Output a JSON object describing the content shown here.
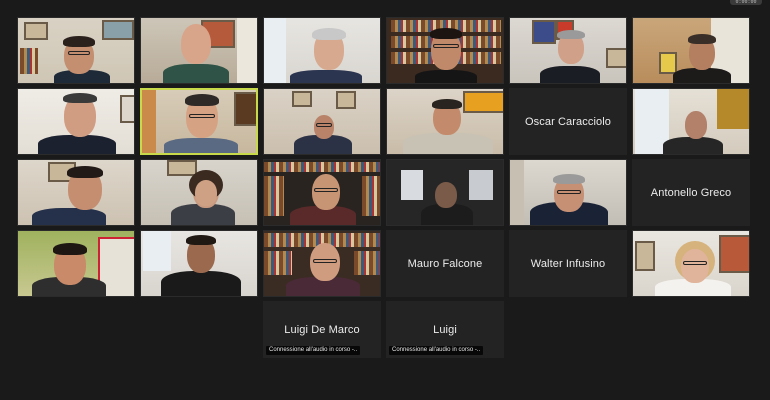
{
  "meeting": {
    "time_badge": "0:00:00"
  },
  "participants": [
    {
      "id": "p1",
      "name": ""
    },
    {
      "id": "p2",
      "name": ""
    },
    {
      "id": "p3",
      "name": ""
    },
    {
      "id": "p4",
      "name": ""
    },
    {
      "id": "p5",
      "name": ""
    },
    {
      "id": "p6",
      "name": ""
    },
    {
      "id": "p7",
      "name": ""
    },
    {
      "id": "p8",
      "name": "",
      "speaking": true
    },
    {
      "id": "p9",
      "name": ""
    },
    {
      "id": "p10",
      "name": ""
    },
    {
      "id": "p11",
      "name": "Oscar Caracciolo",
      "video": false
    },
    {
      "id": "p12",
      "name": ""
    },
    {
      "id": "p13",
      "name": ""
    },
    {
      "id": "p14",
      "name": ""
    },
    {
      "id": "p15",
      "name": ""
    },
    {
      "id": "p16",
      "name": ""
    },
    {
      "id": "p17",
      "name": ""
    },
    {
      "id": "p18",
      "name": "Antonello Greco",
      "video": false
    },
    {
      "id": "p19",
      "name": ""
    },
    {
      "id": "p20",
      "name": ""
    },
    {
      "id": "p21",
      "name": ""
    },
    {
      "id": "p22",
      "name": "Mauro Falcone",
      "video": false
    },
    {
      "id": "p23",
      "name": "Walter Infusino",
      "video": false
    },
    {
      "id": "p24",
      "name": ""
    },
    {
      "id": "p25",
      "name": "Luigi De Marco",
      "video": false,
      "status": "Connessione all'audio in corso -.."
    },
    {
      "id": "p26",
      "name": "Luigi",
      "video": false,
      "status": "Connessione all'audio in corso -.."
    }
  ],
  "colors": {
    "background": "#1a1a1a",
    "name_tile": "#232323",
    "active_speaker_border": "#c8d94a"
  }
}
